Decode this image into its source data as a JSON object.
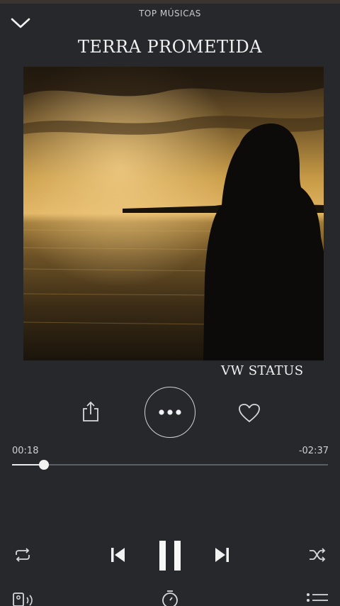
{
  "header": {
    "playlist_label": "TOP MÚSICAS",
    "song_title": "TERRA PROMETIDA",
    "collapse_icon": "chevron-down-icon"
  },
  "artwork": {
    "description_icon": "album-art",
    "caption": "VW STATUS"
  },
  "actions": {
    "share_icon": "share-icon",
    "more_icon": "more-options-icon",
    "like_icon": "heart-icon"
  },
  "progress": {
    "elapsed": "00:18",
    "remaining": "-02:37",
    "fraction": 0.1
  },
  "controls": {
    "repeat_icon": "repeat-icon",
    "previous_icon": "skip-previous-icon",
    "play_state_icon": "pause-icon",
    "next_icon": "skip-next-icon",
    "shuffle_icon": "shuffle-icon"
  },
  "bottom_bar": {
    "device_icon": "speaker-device-icon",
    "timer_icon": "sleep-timer-icon",
    "queue_icon": "queue-list-icon"
  },
  "colors": {
    "background": "#26282c",
    "foreground": "#e9eaec",
    "track": "#5b5e63"
  }
}
